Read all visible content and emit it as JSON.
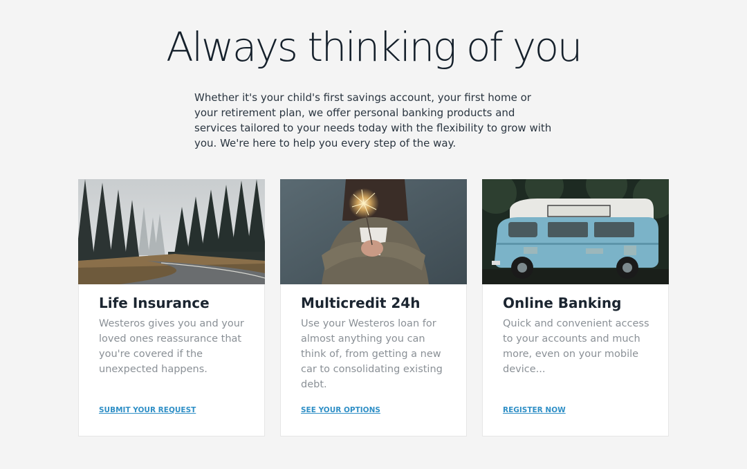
{
  "hero": {
    "title": "Always thinking of you",
    "intro": "Whether it's your child's first savings account, your first home or your retirement plan, we offer personal banking products and services tailored to your needs today with the flexibility to grow with you. We're here to help you every step of the way."
  },
  "cards": [
    {
      "title": "Life Insurance",
      "text": "Westeros gives you and your loved ones reassurance that you're covered if the unexpected happens.",
      "link": "SUBMIT YOUR REQUEST",
      "image": "misty-forest-road-photo"
    },
    {
      "title": "Multicredit 24h",
      "text": "Use your Westeros loan for almost anything you can think of, from getting a new car to consolidating existing debt.",
      "link": "SEE YOUR OPTIONS",
      "image": "sparkler-hands-photo"
    },
    {
      "title": "Online Banking",
      "text": "Quick and convenient access to your accounts and much more, even on your mobile device...",
      "link": "REGISTER NOW",
      "image": "blue-vintage-van-photo"
    }
  ],
  "colors": {
    "page_background": "#f4f4f4",
    "card_background": "#ffffff",
    "heading": "#15202b",
    "muted_text": "#8a9096",
    "link": "#2f8fc6"
  }
}
